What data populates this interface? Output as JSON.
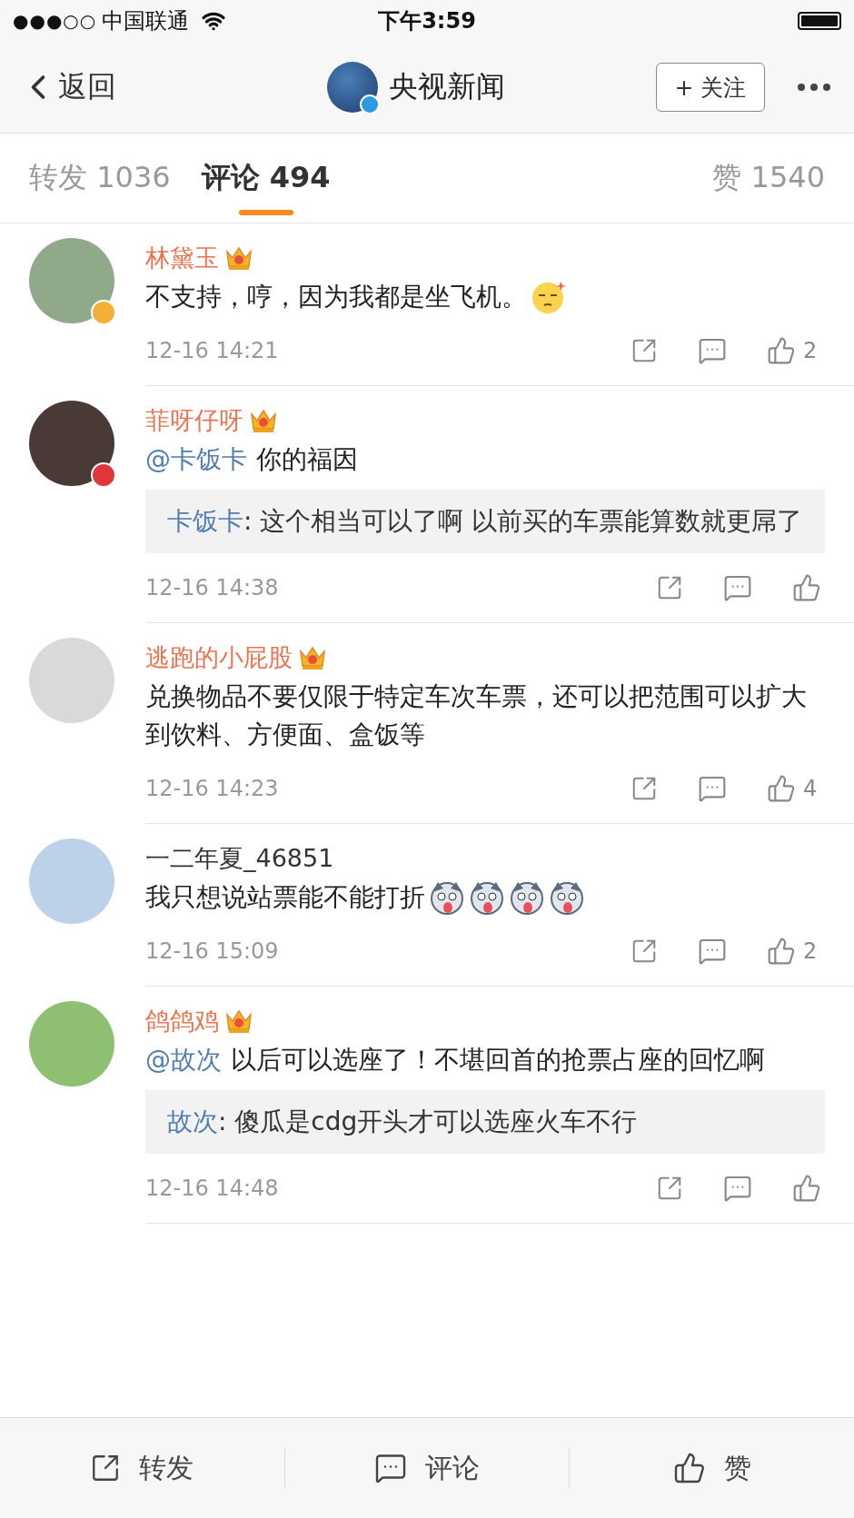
{
  "status_bar": {
    "signal_text": "●●●○○",
    "carrier": "中国联通",
    "time": "下午3:59"
  },
  "nav": {
    "back": "返回",
    "account": "央视新闻",
    "follow": "+ 关注"
  },
  "tabs": [
    {
      "label": "转发 1036",
      "selected": false
    },
    {
      "label": "评论 494",
      "selected": true
    },
    {
      "label": "赞 1540",
      "selected": false
    }
  ],
  "comments": [
    {
      "name": "林黛玉",
      "vip": true,
      "badge": {
        "kind": "verified"
      },
      "text": "不支持，哼，因为我都是坐飞机。",
      "emojis": [
        {
          "kind": "smug"
        }
      ],
      "time": "12-16 14:21",
      "likes": "2"
    },
    {
      "name": "菲呀仔呀",
      "vip": true,
      "badge": {
        "kind": "star"
      },
      "mention": "@卡饭卡",
      "text": "你的福因",
      "quote": {
        "author": "卡饭卡",
        "separator": ":",
        "text": "这个相当可以了啊 以前买的车票能算数就更屌了"
      },
      "time": "12-16 14:38"
    },
    {
      "name": "逃跑的小屁股",
      "vip": true,
      "text": "兑换物品不要仅限于特定车次车票，还可以把范围可以扩大到饮料、方便面、盒饭等",
      "time": "12-16 14:23",
      "likes": "4"
    },
    {
      "name": "一二年夏_46851",
      "vip": false,
      "text": "我只想说站票能不能打折",
      "emojis": [
        {
          "kind": "dog"
        },
        {
          "kind": "dog"
        },
        {
          "kind": "dog"
        },
        {
          "kind": "dog"
        }
      ],
      "time": "12-16 15:09",
      "likes": "2"
    },
    {
      "name": "鸽鸽鸡",
      "vip": true,
      "mention": "@故次",
      "text": "以后可以选座了！不堪回首的抢票占座的回忆啊",
      "quote": {
        "author": "故次",
        "separator": ":",
        "text": "傻瓜是cdg开头才可以选座火车不行"
      },
      "time": "12-16 14:48"
    }
  ],
  "bottom_bar": [
    {
      "kind": "repost",
      "label": "转发"
    },
    {
      "kind": "comment",
      "label": "评论"
    },
    {
      "kind": "like",
      "label": "赞"
    }
  ]
}
